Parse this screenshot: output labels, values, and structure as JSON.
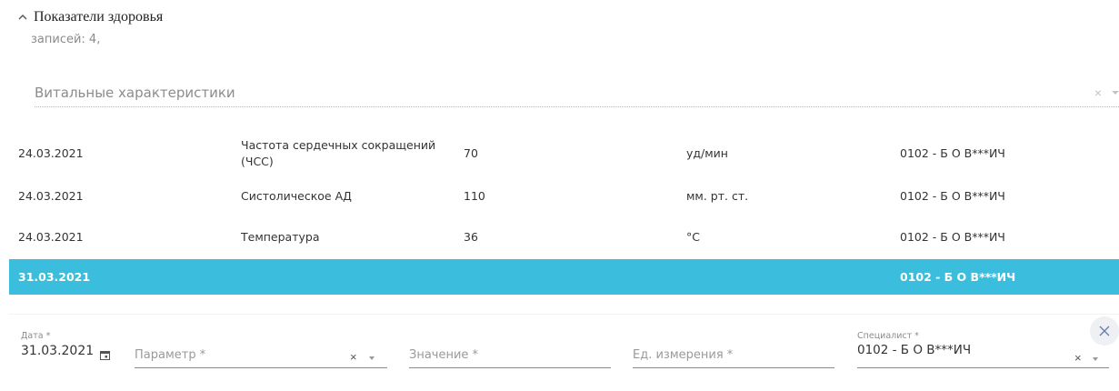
{
  "section": {
    "title": "Показатели здоровья",
    "records_text": "записей: 4,"
  },
  "filter": {
    "label": "Витальные характеристики",
    "clear_icon": "×"
  },
  "rows": [
    {
      "date": "24.03.2021",
      "parameter": "Частота сердечных сокращений (ЧСС)",
      "value": "70",
      "unit": "уд/мин",
      "specialist": "0102 - Б О В***ИЧ"
    },
    {
      "date": "24.03.2021",
      "parameter": "Систолическое АД",
      "value": "110",
      "unit": "мм. рт. ст.",
      "specialist": "0102 - Б О В***ИЧ"
    },
    {
      "date": "24.03.2021",
      "parameter": "Температура",
      "value": "36",
      "unit": "°С",
      "specialist": "0102 - Б О В***ИЧ"
    },
    {
      "date": "31.03.2021",
      "parameter": "",
      "value": "",
      "unit": "",
      "specialist": "0102 - Б О В***ИЧ"
    }
  ],
  "colors": {
    "selected_row": "#3bbedd"
  },
  "form": {
    "date_label": "Дата *",
    "date_value": "31.03.2021",
    "parameter_placeholder": "Параметр *",
    "value_placeholder": "Значение *",
    "unit_placeholder": "Ед. измерения *",
    "specialist_label": "Специалист *",
    "specialist_value": "0102 - Б О В***ИЧ",
    "clear_icon": "×"
  },
  "icons": {
    "collapse": "chevron-up-icon",
    "calendar": "calendar-icon",
    "close": "close-icon"
  }
}
